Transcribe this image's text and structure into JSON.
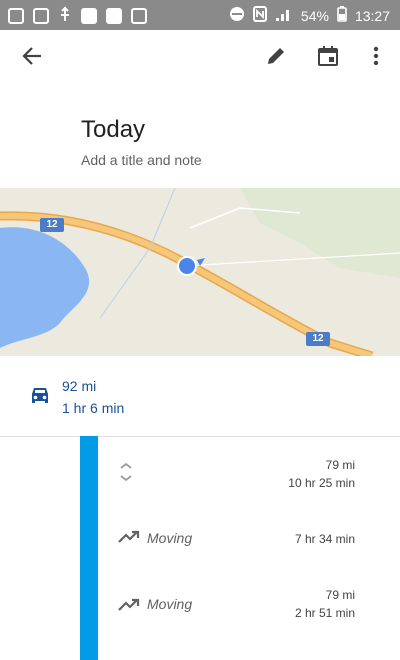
{
  "status_bar": {
    "battery": "54%",
    "time": "13:27"
  },
  "toolbar": {
    "back_icon": "arrow-back-icon",
    "edit_icon": "pencil-icon",
    "calendar_icon": "calendar-icon",
    "more_icon": "more-vert-icon"
  },
  "header": {
    "title": "Today",
    "subtitle": "Add a title and note"
  },
  "map": {
    "route_labels": [
      "12",
      "12"
    ],
    "accent": "#f2b65b",
    "water": "#8ab6f1"
  },
  "summary": {
    "distance": "92 mi",
    "duration": "1 hr 6 min"
  },
  "timeline": {
    "rows": [
      {
        "label": "",
        "icon": "chevron-collapse-icon",
        "distance": "79 mi",
        "time": "10 hr 25 min"
      },
      {
        "label": "Moving",
        "icon": "trending-icon",
        "distance": "",
        "time": "7 hr 34 min"
      },
      {
        "label": "Moving",
        "icon": "trending-icon",
        "distance": "79 mi",
        "time": "2 hr 51 min"
      }
    ]
  }
}
